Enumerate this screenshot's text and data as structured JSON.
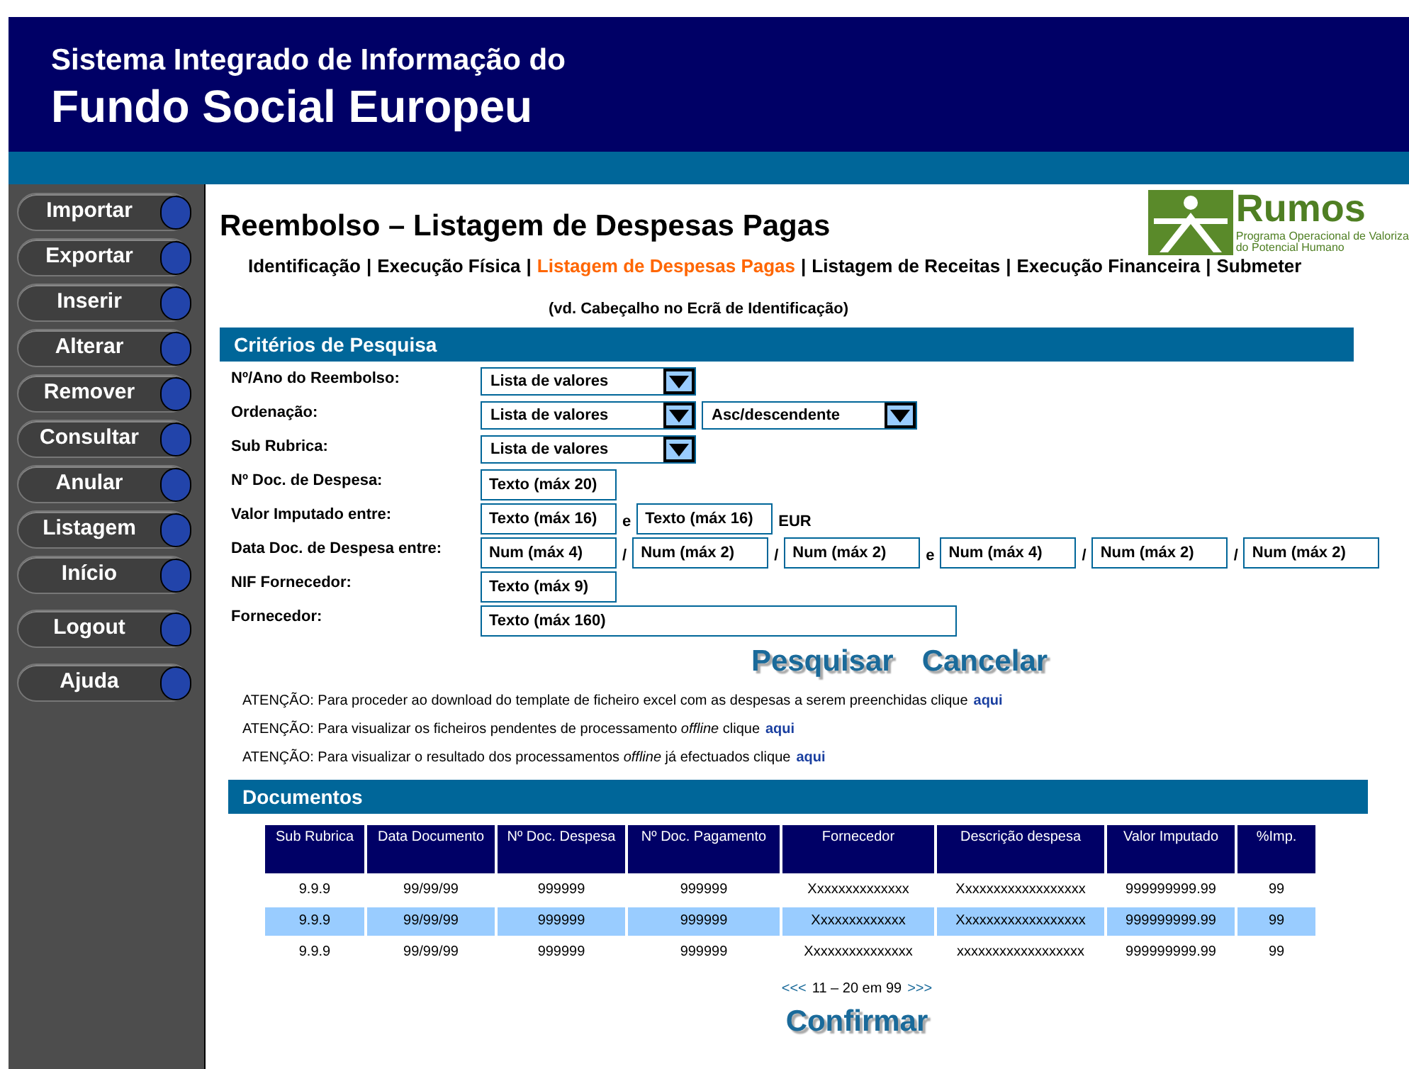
{
  "header": {
    "line_1": "Sistema Integrado de Informação do",
    "line_2": "Fundo Social Europeu"
  },
  "sidebar": {
    "items": [
      {
        "label": "Importar"
      },
      {
        "label": "Exportar"
      },
      {
        "label": "Inserir"
      },
      {
        "label": "Alterar"
      },
      {
        "label": "Remover"
      },
      {
        "label": "Consultar"
      },
      {
        "label": "Anular"
      },
      {
        "label": "Listagem"
      },
      {
        "label": "Início"
      },
      {
        "label": "Logout"
      },
      {
        "label": "Ajuda"
      }
    ]
  },
  "logo": {
    "name": "Rumos",
    "line_1": "Programa Operacional de Valoriza",
    "line_2": "do Potencial Humano"
  },
  "page_title": "Reembolso – Listagem de Despesas Pagas",
  "tabs": [
    {
      "label": "Identificação",
      "selected": false
    },
    {
      "label": "Execução Física",
      "selected": false
    },
    {
      "label": "Listagem de Despesas Pagas",
      "selected": true
    },
    {
      "label": "Listagem de Receitas",
      "selected": false
    },
    {
      "label": "Execução Financeira",
      "selected": false
    },
    {
      "label": "Submeter",
      "selected": false
    }
  ],
  "tab_separators": [
    "|",
    "|",
    "|",
    "|",
    "|"
  ],
  "subtitle": "(vd. Cabeçalho no Ecrã de Identificação)",
  "criteria": {
    "title": "Critérios de Pesquisa",
    "rows": [
      {
        "label": "Nº/Ano do Reembolso:",
        "controls": [
          {
            "kind": "select",
            "text": "Lista de valores"
          }
        ]
      },
      {
        "label": "Ordenação:",
        "controls": [
          {
            "kind": "select",
            "text": "Lista de valores"
          },
          {
            "kind": "select",
            "text": "Asc/descendente"
          }
        ]
      },
      {
        "label": "Sub Rubrica:",
        "controls": [
          {
            "kind": "select",
            "text": "Lista de valores"
          }
        ]
      },
      {
        "label": "Nº Doc. de Despesa:",
        "controls": [
          {
            "kind": "input",
            "text": "Texto (máx 20)"
          }
        ]
      },
      {
        "label": "Valor Imputado entre:",
        "controls": [
          {
            "kind": "input",
            "text": "Texto (máx 16)"
          },
          {
            "kind": "label",
            "text": "e"
          },
          {
            "kind": "input",
            "text": "Texto (máx 16)"
          },
          {
            "kind": "label",
            "text": "EUR"
          }
        ]
      },
      {
        "label": "Data Doc. de Despesa entre:",
        "controls": [
          {
            "kind": "input",
            "text": "Num (máx 4)"
          },
          {
            "kind": "label",
            "text": "/"
          },
          {
            "kind": "input",
            "text": "Num (máx 2)"
          },
          {
            "kind": "label",
            "text": "/"
          },
          {
            "kind": "input",
            "text": "Num (máx 2)"
          },
          {
            "kind": "label",
            "text": "e"
          },
          {
            "kind": "input",
            "text": "Num (máx 4)"
          },
          {
            "kind": "label",
            "text": "/"
          },
          {
            "kind": "input",
            "text": "Num (máx 2)"
          },
          {
            "kind": "label",
            "text": "/"
          },
          {
            "kind": "input",
            "text": "Num (máx 2)"
          }
        ]
      },
      {
        "label": "NIF Fornecedor:",
        "controls": [
          {
            "kind": "input",
            "text": "Texto (máx 9)"
          }
        ]
      },
      {
        "label": "Fornecedor:",
        "controls": [
          {
            "kind": "wide",
            "text": "Texto (máx 160)"
          }
        ]
      }
    ]
  },
  "actions": [
    "Pesquisar",
    "Cancelar"
  ],
  "notices": [
    {
      "text": "ATENÇÃO: Para proceder ao download do template de ficheiro excel com as despesas a serem preenchidas clique",
      "link": "aqui"
    },
    {
      "text": "ATENÇÃO: Para visualizar os ficheiros pendentes de processamento *offline* clique",
      "link": "aqui"
    },
    {
      "text": "ATENÇÃO: Para visualizar o resultado dos processamentos *offline* já efectuados clique",
      "link": "aqui"
    }
  ],
  "documents": {
    "title": "Documentos",
    "columns": [
      "Sub Rubrica",
      "Data Documento",
      "Nº Doc. Despesa",
      "Nº Doc. Pagamento",
      "Fornecedor",
      "Descrição despesa",
      "Valor Imputado",
      "%Imp."
    ],
    "rows": [
      {
        "selected": false,
        "cells": [
          "9.9.9",
          "99/99/99",
          "999999",
          "999999",
          "Xxxxxxxxxxxxxx",
          "Xxxxxxxxxxxxxxxxxx",
          "999999999.99",
          "99"
        ]
      },
      {
        "selected": true,
        "cells": [
          "9.9.9",
          "99/99/99",
          "999999",
          "999999",
          "Xxxxxxxxxxxxx",
          "Xxxxxxxxxxxxxxxxxx",
          "999999999.99",
          "99"
        ]
      },
      {
        "selected": false,
        "cells": [
          "9.9.9",
          "99/99/99",
          "999999",
          "999999",
          "Xxxxxxxxxxxxxxx",
          "xxxxxxxxxxxxxxxxxx",
          "999999999.99",
          "99"
        ]
      }
    ]
  },
  "pagination": {
    "previous": "<<<",
    "range": "11 – 20 em 99",
    "next": ">>>"
  },
  "confirm": "Confirmar"
}
